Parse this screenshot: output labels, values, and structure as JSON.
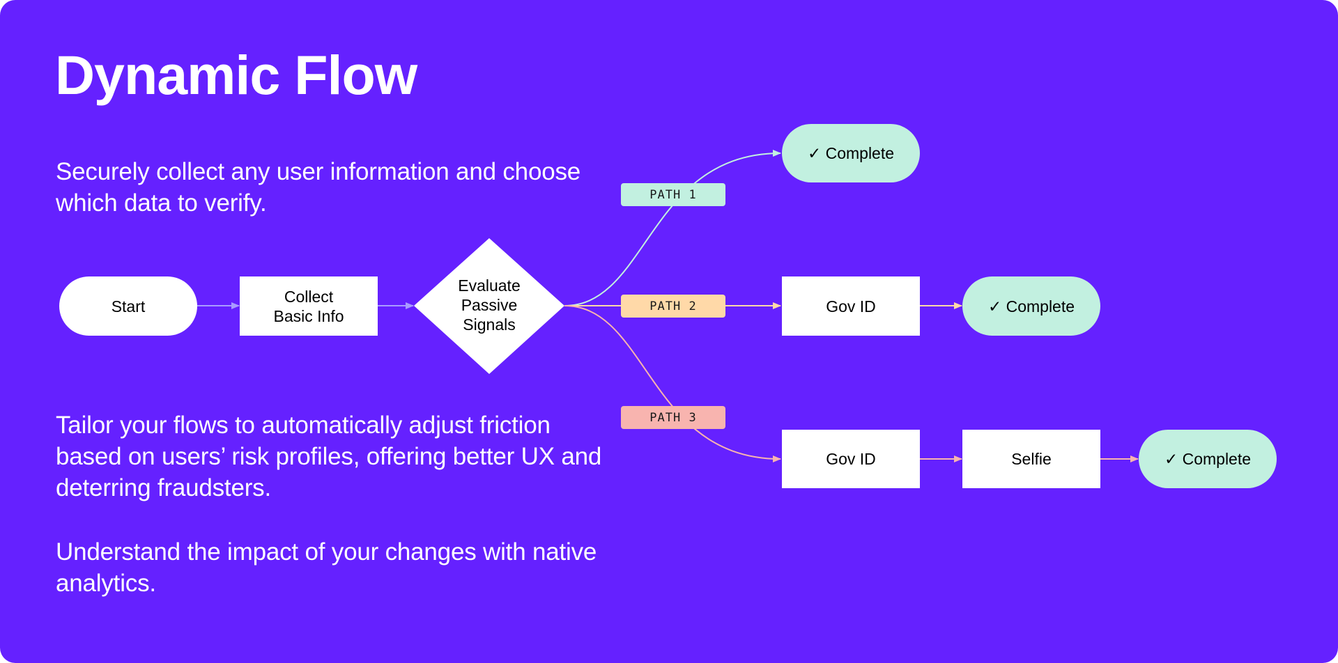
{
  "header": {
    "title": "Dynamic Flow"
  },
  "description": [
    "Securely collect any user information and choose which data to verify.",
    "Tailor your flows to automatically adjust friction based on users’ risk profiles, offering better UX and deterring fraudsters.",
    "Understand the impact of your changes with native analytics."
  ],
  "colors": {
    "background": "#6521FF",
    "node_white": "#FFFFFF",
    "node_complete": "#C2F0E0",
    "arrow_main": "#A99BFF",
    "path1": "#C2F0E0",
    "path2": "#FFD9A8",
    "path3": "#F8B4AF"
  },
  "flow": {
    "start": "Start",
    "collect_line1": "Collect",
    "collect_line2": "Basic Info",
    "decision_line1": "Evaluate",
    "decision_line2": "Passive",
    "decision_line3": "Signals",
    "paths": [
      {
        "label": "PATH 1",
        "steps": [],
        "end": "✓ Complete"
      },
      {
        "label": "PATH 2",
        "steps": [
          "Gov ID"
        ],
        "end": "✓ Complete"
      },
      {
        "label": "PATH 3",
        "steps": [
          "Gov ID",
          "Selfie"
        ],
        "end": "✓ Complete"
      }
    ]
  }
}
